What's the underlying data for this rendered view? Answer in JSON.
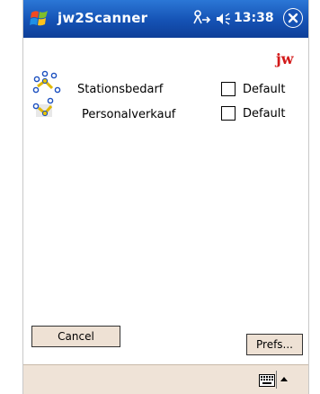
{
  "titlebar": {
    "app_title": "jw2Scanner",
    "clock": "13:38"
  },
  "logo_text": "jw",
  "rows": [
    {
      "label": "Stationsbedarf",
      "default_label": "Default",
      "default_checked": false,
      "icon": "station-molecule-icon"
    },
    {
      "label": "Personalverkauf",
      "default_label": "Default",
      "default_checked": false,
      "icon": "personal-molecule-icon"
    }
  ],
  "buttons": {
    "cancel": "Cancel",
    "prefs": "Prefs..."
  },
  "menubar": {
    "keyboard_icon": "keyboard-icon",
    "sip_arrow_icon": "arrow-up-icon"
  },
  "colors": {
    "titlebar": "#1552b4",
    "logo": "#d31a1a",
    "button_bg": "#eee1d4",
    "menubar_bg": "#efe3d7"
  }
}
